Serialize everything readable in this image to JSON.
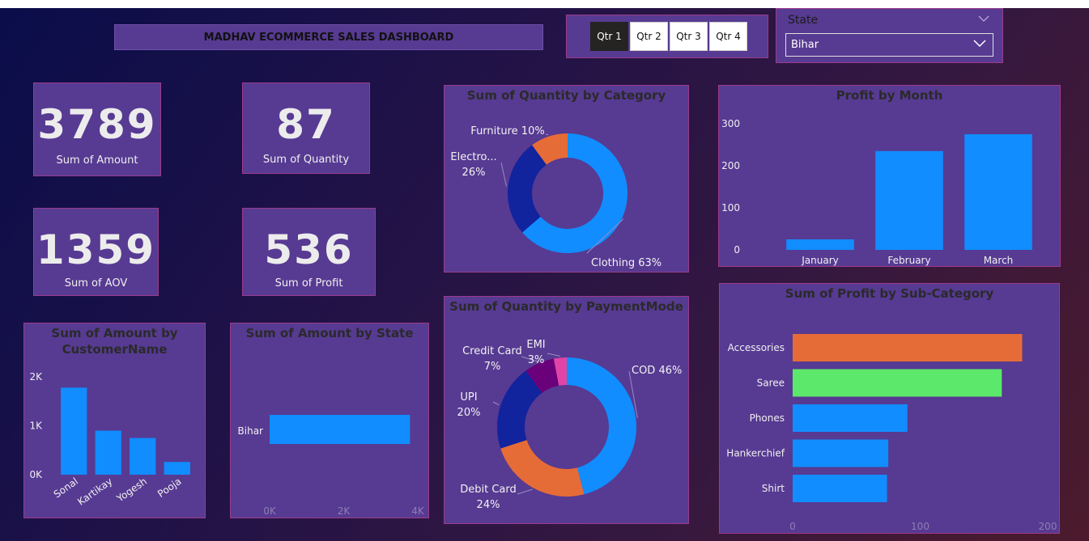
{
  "title": "MADHAV ECOMMERCE SALES DASHBOARD",
  "quarters": [
    "Qtr 1",
    "Qtr 2",
    "Qtr 3",
    "Qtr 4"
  ],
  "active_quarter": "Qtr 1",
  "state_filter": {
    "label": "State",
    "value": "Bihar"
  },
  "kpis": {
    "amount": {
      "value": "3789",
      "label": "Sum of Amount"
    },
    "quantity": {
      "value": "87",
      "label": "Sum of Quantity"
    },
    "aov": {
      "value": "1359",
      "label": "Sum of AOV"
    },
    "profit": {
      "value": "536",
      "label": "Sum of Profit"
    }
  },
  "colors": {
    "blue": "#118dff",
    "navy": "#12239e",
    "orange": "#e66c37",
    "purple": "#6b007b",
    "pink": "#e044a7",
    "green": "#5ce86a"
  },
  "chart_data": [
    {
      "id": "qty_by_category",
      "type": "pie",
      "title": "Sum of Quantity by Category",
      "labels": [
        "Clothing",
        "Electronics",
        "Furniture"
      ],
      "display_labels": [
        "Clothing 63%",
        [
          "Electro...",
          "26%"
        ],
        "Furniture 10%"
      ],
      "values": [
        63,
        26,
        10
      ],
      "colors": [
        "#118dff",
        "#12239e",
        "#e66c37"
      ]
    },
    {
      "id": "profit_by_month",
      "type": "bar",
      "title": "Profit by Month",
      "categories": [
        "January",
        "February",
        "March"
      ],
      "values": [
        25,
        235,
        275
      ],
      "ylim": [
        0,
        300
      ],
      "yticks": [
        "0",
        "100",
        "200",
        "300"
      ]
    },
    {
      "id": "amount_by_customer",
      "type": "bar",
      "title": [
        "Sum of Amount by",
        "CustomerName"
      ],
      "categories": [
        "Sonal",
        "Kartikay",
        "Yogesh",
        "Pooja"
      ],
      "values": [
        1780,
        900,
        750,
        260
      ],
      "ylim": [
        0,
        2000
      ],
      "yticks": [
        "0K",
        "1K",
        "2K"
      ]
    },
    {
      "id": "amount_by_state",
      "type": "bar",
      "title": "Sum of Amount by State",
      "categories": [
        "Bihar"
      ],
      "values": [
        3789
      ],
      "xlim": [
        0,
        4000
      ],
      "xticks": [
        "0K",
        "2K",
        "4K"
      ]
    },
    {
      "id": "qty_by_payment",
      "type": "pie",
      "title": "Sum of Quantity by PaymentMode",
      "labels": [
        "COD",
        "Debit Card",
        "UPI",
        "Credit Card",
        "EMI"
      ],
      "display_labels": [
        "COD 46%",
        [
          "Debit Card",
          "24%"
        ],
        [
          "UPI",
          "20%"
        ],
        [
          "Credit Card",
          "7%"
        ],
        [
          "EMI",
          "3%"
        ]
      ],
      "values": [
        46,
        24,
        20,
        7,
        3
      ],
      "colors": [
        "#118dff",
        "#e66c37",
        "#12239e",
        "#6b007b",
        "#e044a7"
      ]
    },
    {
      "id": "profit_by_subcategory",
      "type": "bar",
      "title": "Sum of Profit by Sub-Category",
      "categories": [
        "Accessories",
        "Saree",
        "Phones",
        "Hankerchief",
        "Shirt"
      ],
      "values": [
        180,
        164,
        90,
        75,
        74
      ],
      "xlim": [
        0,
        200
      ],
      "xticks": [
        "0",
        "100",
        "200"
      ],
      "colors": [
        "#e66c37",
        "#5ce86a",
        "#118dff",
        "#118dff",
        "#118dff"
      ]
    }
  ]
}
